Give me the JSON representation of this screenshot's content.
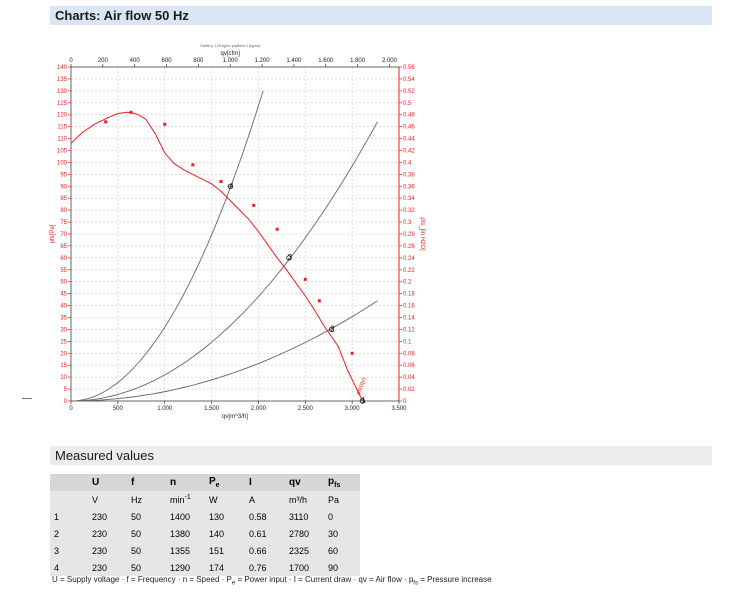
{
  "header": {
    "title": "Charts: Air flow 50 Hz"
  },
  "section2": {
    "title": "Measured values"
  },
  "chart_data": {
    "type": "line",
    "top_caption": "Dichte ρ 1,20 kg/m³ ρ/ρNenn 1 (kg/m³)",
    "x_bottom": {
      "label": "qv[m^3/h]",
      "range": [
        0,
        3500
      ],
      "ticks": [
        0,
        500,
        1000,
        1500,
        2000,
        2500,
        3000,
        3500
      ],
      "tick_labels": [
        "0",
        "500",
        "1.000",
        "1.500",
        "2.000",
        "2.500",
        "3.000",
        "3.500"
      ]
    },
    "x_top": {
      "label": "qv[cfm]",
      "range": [
        0,
        2060
      ],
      "ticks": [
        0,
        200,
        400,
        600,
        800,
        1000,
        1200,
        1400,
        1600,
        1800,
        2000
      ],
      "tick_labels": [
        "0",
        "200",
        "400",
        "600",
        "800",
        "1.000",
        "1.200",
        "1.400",
        "1.600",
        "1.800",
        "2.000"
      ]
    },
    "y_left": {
      "label": "pfs[Pa]",
      "range": [
        0,
        140
      ],
      "ticks": [
        0,
        5,
        10,
        15,
        20,
        25,
        30,
        35,
        40,
        45,
        50,
        55,
        60,
        65,
        70,
        75,
        80,
        85,
        90,
        95,
        100,
        105,
        110,
        115,
        120,
        125,
        130,
        135,
        140
      ]
    },
    "y_right": {
      "label": "pfs_[in H2O]",
      "range": [
        0,
        0.56
      ],
      "ticks": [
        0,
        0.02,
        0.04,
        0.06,
        0.08,
        0.1,
        0.12,
        0.14,
        0.16,
        0.18,
        0.2,
        0.22,
        0.24,
        0.26,
        0.28,
        0.3,
        0.32,
        0.34,
        0.36,
        0.38,
        0.4,
        0.42,
        0.44,
        0.46,
        0.48,
        0.5,
        0.52,
        0.54,
        0.56
      ],
      "tick_labels": [
        "0",
        "0.02",
        "0.04",
        "0.06",
        "0.08",
        "0.1",
        "0.12",
        "0.14",
        "0.16",
        "0.18",
        "0.2",
        "0.22",
        "0.24",
        "0.26",
        "0.28",
        "0.3",
        "0.32",
        "0.34",
        "0.36",
        "0.38",
        "0.4",
        "0.42",
        "0.44",
        "0.46",
        "0.48",
        "0.5",
        "0.52",
        "0.54",
        "0.56"
      ]
    },
    "grid": true,
    "series": [
      {
        "name": "pfs",
        "color": "#e8201f",
        "x": [
          0,
          120,
          250,
          380,
          500,
          600,
          650,
          720,
          800,
          900,
          1000,
          1100,
          1200,
          1300,
          1400,
          1500,
          1600,
          1700,
          1800,
          1900,
          2000,
          2100,
          2200,
          2300,
          2400,
          2500,
          2600,
          2700,
          2780,
          2850,
          2950,
          3050,
          3110
        ],
        "y": [
          108,
          112.5,
          116,
          118.5,
          120.5,
          121,
          120.8,
          120,
          118,
          112,
          104,
          99.5,
          97,
          95,
          93,
          91,
          88,
          84,
          80,
          76,
          71,
          65.5,
          60,
          55,
          49.5,
          44,
          38,
          31.5,
          27,
          23,
          13,
          5,
          0
        ]
      },
      {
        "color": "#666666",
        "x": [
          0,
          1000,
          2050
        ],
        "y": [
          0,
          33,
          130
        ]
      },
      {
        "color": "#666666",
        "x": [
          0,
          1000,
          3270
        ],
        "y": [
          0,
          11.5,
          117
        ]
      },
      {
        "color": "#666666",
        "x": [
          0,
          1000,
          3270
        ],
        "y": [
          0,
          4,
          42
        ]
      }
    ],
    "markers_x": [
      370,
      640,
      1000,
      1300,
      1600,
      1950,
      2200,
      2500,
      2650,
      3000
    ],
    "markers_y": [
      117,
      121,
      116,
      99,
      92,
      82,
      72,
      51,
      42,
      20
    ],
    "operating_points": [
      {
        "label": "4",
        "x": 1700,
        "y": 90
      },
      {
        "label": "3",
        "x": 2325,
        "y": 60
      },
      {
        "label": "2",
        "x": 2780,
        "y": 30
      },
      {
        "label": "1",
        "x": 3110,
        "y": 0
      }
    ],
    "curve_label": "pfs(qv)"
  },
  "table": {
    "headers": [
      "U",
      "f",
      "n",
      "P",
      "I",
      "qv",
      "p"
    ],
    "header_subs": [
      "",
      "",
      "",
      "e",
      "",
      "",
      "fs"
    ],
    "units": [
      "V",
      "Hz",
      "min",
      "W",
      "A",
      "m³/h",
      "Pa"
    ],
    "n_unit_sup": "-1",
    "rows": [
      [
        "1",
        "230",
        "50",
        "1400",
        "130",
        "0.58",
        "3110",
        "0"
      ],
      [
        "2",
        "230",
        "50",
        "1380",
        "140",
        "0.61",
        "2780",
        "30"
      ],
      [
        "3",
        "230",
        "50",
        "1355",
        "151",
        "0.66",
        "2325",
        "60"
      ],
      [
        "4",
        "230",
        "50",
        "1290",
        "174",
        "0.76",
        "1700",
        "90"
      ]
    ]
  },
  "legend": {
    "part1": "U = Supply voltage · f = Frequency · n = Speed · P",
    "sub1": "e",
    "part2": " = Power input · I = Current draw · qv = Air flow · p",
    "sub2": "fs",
    "part3": " = Pressure increase"
  }
}
